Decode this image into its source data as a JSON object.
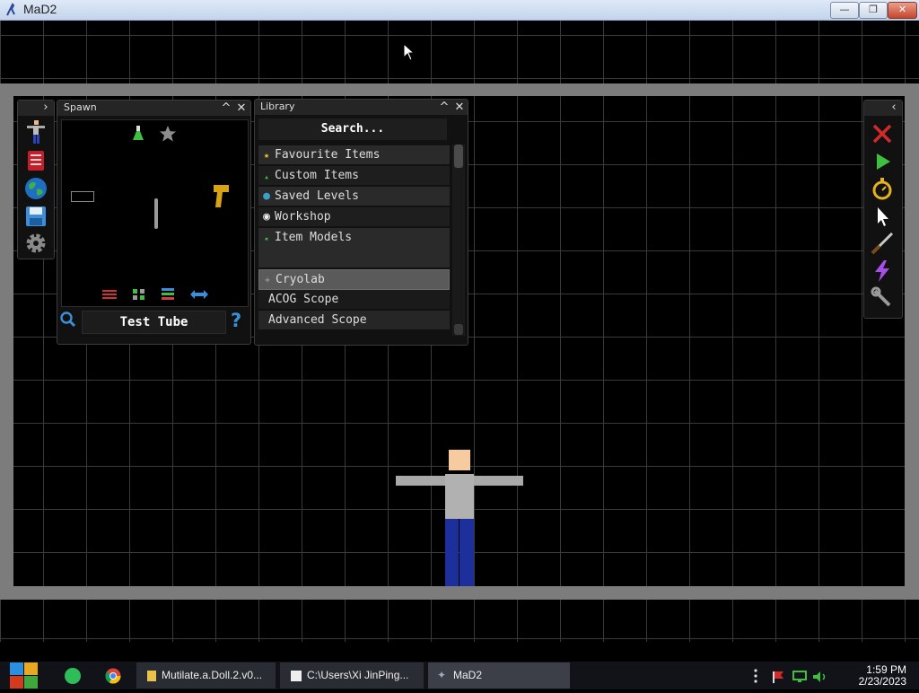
{
  "window": {
    "title": "MaD2",
    "btn_minimize": "—",
    "btn_restore": "❐",
    "btn_close": "✕"
  },
  "left_toolbar": {
    "expand_icon": "›"
  },
  "spawn_panel": {
    "title": "Spawn",
    "collapse_icon": "^",
    "close_icon": "✕",
    "selected_item": "Test Tube",
    "search_icon": "🔍",
    "help_icon": "?"
  },
  "library_panel": {
    "title": "Library",
    "collapse_icon": "^",
    "close_icon": "✕",
    "search_placeholder": "Search...",
    "categories": [
      {
        "label": "Favourite Items",
        "icon": "★"
      },
      {
        "label": "Custom Items",
        "icon": "▲"
      },
      {
        "label": "Saved Levels",
        "icon": "●"
      },
      {
        "label": "Workshop",
        "icon": "◉"
      },
      {
        "label": "Item Models",
        "icon": "▪"
      }
    ],
    "items": [
      {
        "label": "Cryolab",
        "icon": "+",
        "selected": true
      },
      {
        "label": "ACOG Scope",
        "icon": "",
        "selected": false
      },
      {
        "label": "Advanced Scope",
        "icon": "",
        "selected": false
      }
    ]
  },
  "right_toolbar": {
    "collapse_icon": "‹",
    "tools": [
      "delete-tool",
      "play-tool",
      "stopwatch-tool",
      "pointer-tool",
      "knife-tool",
      "lightning-tool",
      "wrench-tool"
    ]
  },
  "taskbar": {
    "tasks": [
      {
        "label": "Mutilate.a.Doll.2.v0..."
      },
      {
        "label": "C:\\Users\\Xi JinPing..."
      },
      {
        "label": "MaD2"
      }
    ],
    "time": "1:59 PM",
    "date": "2/23/2023"
  },
  "colors": {
    "accent_green": "#3fbf3f",
    "delete_red": "#d22a2a",
    "selected_row": "#5a5a5a"
  }
}
